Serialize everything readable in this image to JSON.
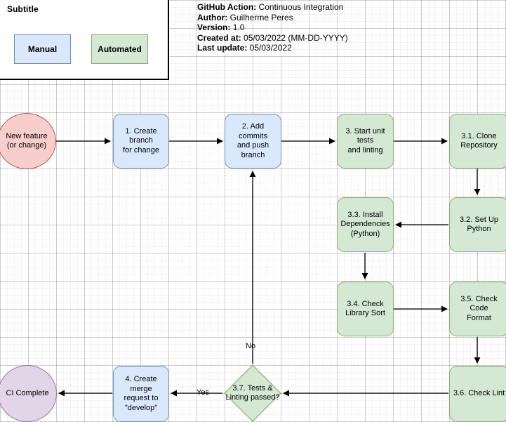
{
  "legend": {
    "title": "Subtitle",
    "chips": [
      {
        "label": "Manual",
        "fill": "#dae8fc",
        "stroke": "#6c8ebf"
      },
      {
        "label": "Automated",
        "fill": "#d5e8d4",
        "stroke": "#82b366"
      }
    ]
  },
  "meta": {
    "rows": [
      {
        "key": "GitHub Action:",
        "value": " Continuous Integration"
      },
      {
        "key": "Author:",
        "value": " Guilherme Peres"
      },
      {
        "key": "Version:",
        "value": " 1.0"
      },
      {
        "key": "Created at:",
        "value": " 05/03/2022 (MM-DD-YYYY)"
      },
      {
        "key": "Last update:",
        "value": " 05/03/2022"
      }
    ]
  },
  "colors": {
    "manual_fill": "#dae8fc",
    "manual_stroke": "#6c8ebf",
    "automated_fill": "#d5e8d4",
    "automated_stroke": "#82b366",
    "start_fill": "#f8cecc",
    "start_stroke": "#b85450",
    "end_fill": "#e1d5e7",
    "end_stroke": "#9673a6",
    "edge": "#000000",
    "grid_minor": "#f0f0f0",
    "grid_major": "#d6d6d6"
  },
  "nodes": {
    "start": {
      "label": "New feature\n(or change)",
      "line1": "New feature",
      "line2": "(or change)",
      "type": "start-circle"
    },
    "n1": {
      "line1": "1. Create branch",
      "line2": "for change",
      "type": "manual-box"
    },
    "n2": {
      "line1": "2. Add commits",
      "line2": "and push branch",
      "type": "manual-box"
    },
    "n3": {
      "line1": "3. Start unit tests",
      "line2": "and linting",
      "type": "automated-box"
    },
    "n31": {
      "line1": "3.1. Clone",
      "line2": "Repository",
      "type": "automated-box"
    },
    "n32": {
      "line1": "3.2. Set Up",
      "line2": "Python",
      "type": "automated-box"
    },
    "n33": {
      "line1": "3.3. Install",
      "line2": "Dependencies",
      "line3": "(Python)",
      "type": "automated-box"
    },
    "n34": {
      "line1": "3.4. Check",
      "line2": "Library Sort",
      "type": "automated-box"
    },
    "n35": {
      "line1": "3.5. Check Code",
      "line2": "Format",
      "type": "automated-box"
    },
    "n36": {
      "line1": "3.6. Check Lint",
      "type": "automated-box"
    },
    "n37": {
      "line1": "3.7. Tests &",
      "line2": "Linting passed?",
      "type": "automated-diamond"
    },
    "n4": {
      "line1": "4. Create merge",
      "line2": "request to",
      "line3": "\"develop\"",
      "type": "manual-box"
    },
    "end": {
      "line1": "CI Complete",
      "type": "end-circle"
    }
  },
  "edge_labels": {
    "no": "No",
    "yes": "Yes"
  }
}
